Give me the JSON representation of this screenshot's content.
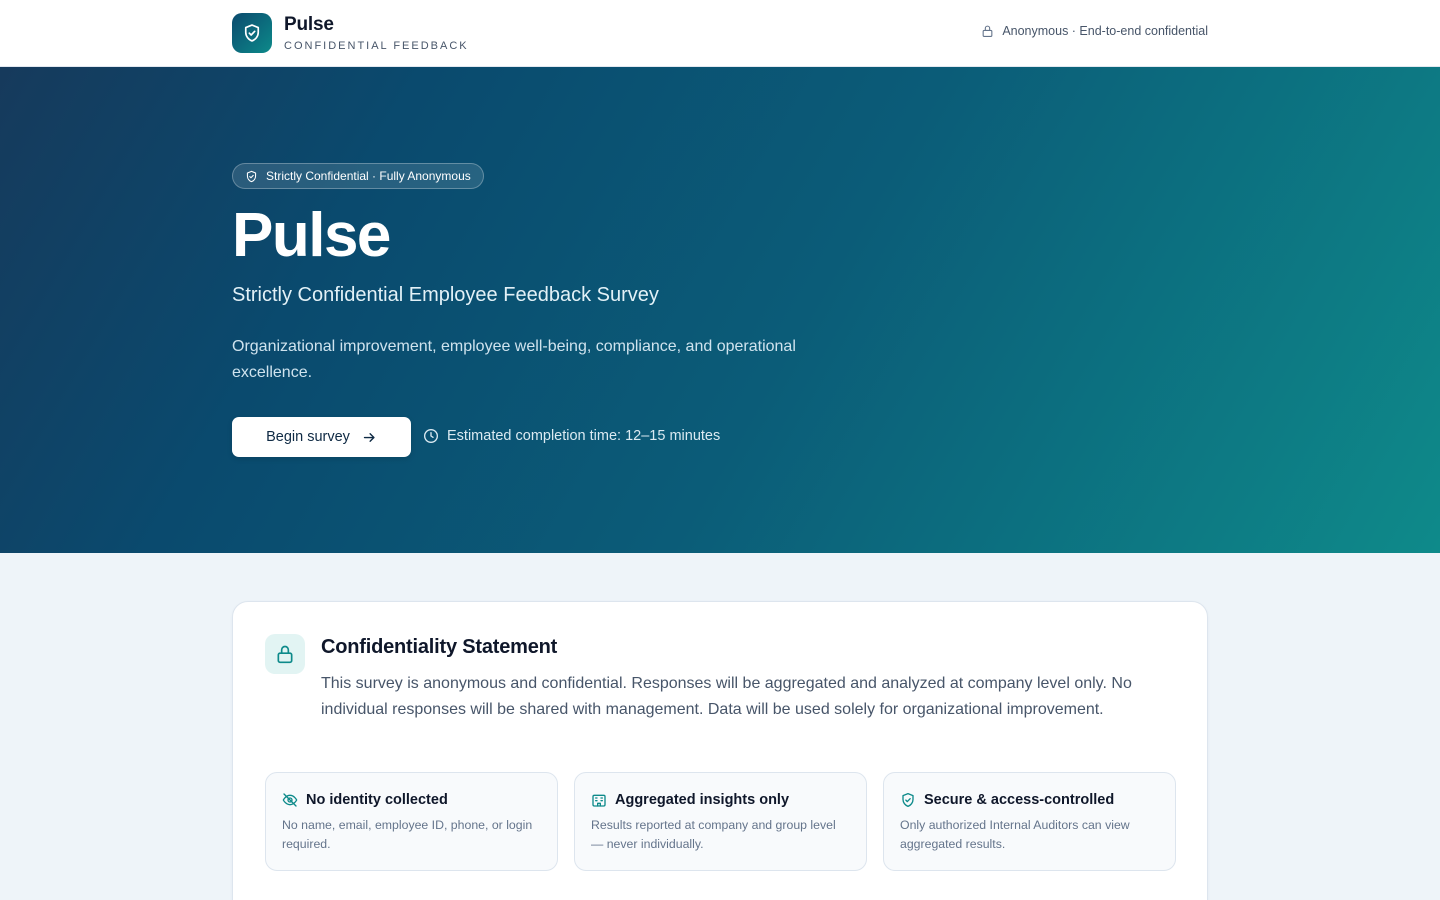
{
  "topbar": {
    "brand_name": "Pulse",
    "brand_subtitle": "CONFIDENTIAL FEEDBACK",
    "meta_text": "Anonymous · End-to-end confidential"
  },
  "hero": {
    "badge": "Strictly Confidential · Fully Anonymous",
    "title": "Pulse",
    "subtitle": "Strictly Confidential Employee Feedback Survey",
    "description": "Organizational improvement, employee well-being, compliance, and operational excellence.",
    "begin_button": "Begin survey",
    "eta": "Estimated completion time: 12–15 minutes"
  },
  "confidentiality": {
    "title": "Confidentiality Statement",
    "body": "This survey is anonymous and confidential. Responses will be aggregated and analyzed at company level only. No individual responses will be shared with management. Data will be used solely for organizational improvement.",
    "features": [
      {
        "icon": "eye-off-icon",
        "title": "No identity collected",
        "description": "No name, email, employee ID, phone, or login required."
      },
      {
        "icon": "building-icon",
        "title": "Aggregated insights only",
        "description": "Results reported at company and group level — never individually."
      },
      {
        "icon": "shield-check-icon",
        "title": "Secure & access-controlled",
        "description": "Only authorized Internal Auditors can view aggregated results."
      }
    ]
  },
  "colors": {
    "accent": "#0d8a8a",
    "hero_start": "#163a5c",
    "hero_end": "#0e8a8a"
  }
}
